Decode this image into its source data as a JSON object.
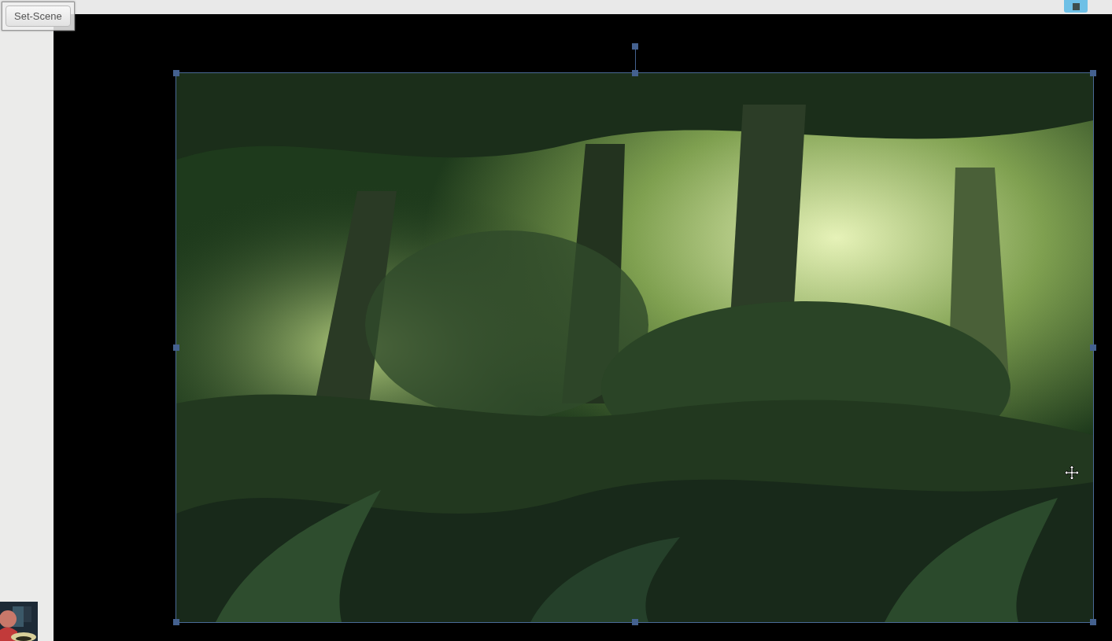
{
  "scene_button": {
    "label": "Set-Scene"
  },
  "canvas": {
    "image": {
      "kind": "picture",
      "selected": true
    }
  },
  "video_feed": {
    "kind": "picture"
  }
}
